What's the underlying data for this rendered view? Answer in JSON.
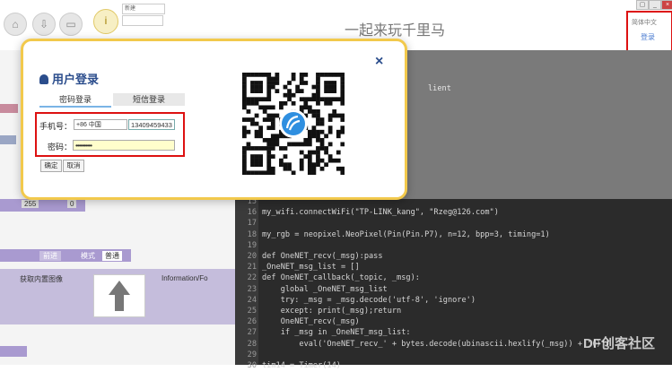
{
  "app": {
    "title": "一起来玩千里马"
  },
  "toolbar": {
    "dropdown_label": "新建"
  },
  "header": {
    "language": "简体中文",
    "login_link": "登录"
  },
  "modal": {
    "title": "用户登录",
    "close": "×",
    "tabs": {
      "password": "密码登录",
      "sms": "短信登录"
    },
    "phone_label": "手机号：",
    "country_code": "+86 中国",
    "phone_value": "13409459433",
    "password_label": "密码：",
    "password_value": "••••••••••",
    "confirm": "确定",
    "cancel": "取消"
  },
  "workspace": {
    "value_255": "255",
    "value_0": "0",
    "forward": "前进",
    "mode": "模式",
    "normal": "普通",
    "get_image": "获取内置图像",
    "info_for": "Information/Fo"
  },
  "editor": {
    "lines": [
      {
        "n": "15",
        "code": ""
      },
      {
        "n": "16",
        "code": "my_wifi.connectWiFi(\"TP-LINK_kang\", \"Rzeg@126.com\")"
      },
      {
        "n": "17",
        "code": ""
      },
      {
        "n": "18",
        "code": "my_rgb = neopixel.NeoPixel(Pin(Pin.P7), n=12, bpp=3, timing=1)"
      },
      {
        "n": "19",
        "code": ""
      },
      {
        "n": "20",
        "code": "def OneNET_recv(_msg):pass"
      },
      {
        "n": "21",
        "code": "_OneNET_msg_list = []"
      },
      {
        "n": "22",
        "code": "def OneNET_callback(_topic, _msg):"
      },
      {
        "n": "23",
        "code": "    global _OneNET_msg_list"
      },
      {
        "n": "24",
        "code": "    try: _msg = _msg.decode('utf-8', 'ignore')"
      },
      {
        "n": "25",
        "code": "    except: print(_msg);return"
      },
      {
        "n": "26",
        "code": "    OneNET_recv(_msg)"
      },
      {
        "n": "27",
        "code": "    if _msg in _OneNET_msg_list:"
      },
      {
        "n": "28",
        "code": "        eval('OneNET_recv_' + bytes.decode(ubinascii.hexlify(_msg)) + '()')"
      },
      {
        "n": "29",
        "code": ""
      },
      {
        "n": "30",
        "code": "tim14 = Timer(14)"
      }
    ],
    "top_snippet": "lient"
  },
  "watermark": "DF创客社区",
  "colors": {
    "accent": "#2b4d8c",
    "highlight_box": "#dd1111",
    "modal_border": "#f2c94c"
  }
}
